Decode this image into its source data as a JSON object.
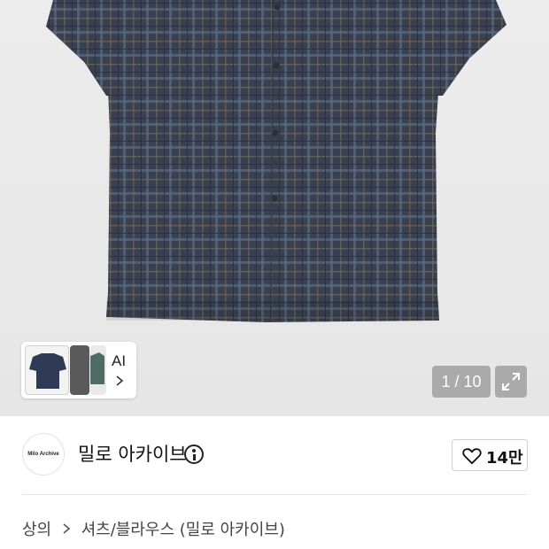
{
  "gallery": {
    "ai_label": "AI",
    "counter": "1 / 10"
  },
  "store": {
    "logo_text": "Milo Archive",
    "name": "밀로 아카이브",
    "like_count": "14만"
  },
  "breadcrumb": {
    "category": "상의",
    "subcategory": "셔츠/블라우스 (밀로 아카이브)"
  },
  "colors": {
    "shirt_base": "#3b4150",
    "shirt_plaid": "#5b6b8a",
    "accent": "#111111"
  }
}
